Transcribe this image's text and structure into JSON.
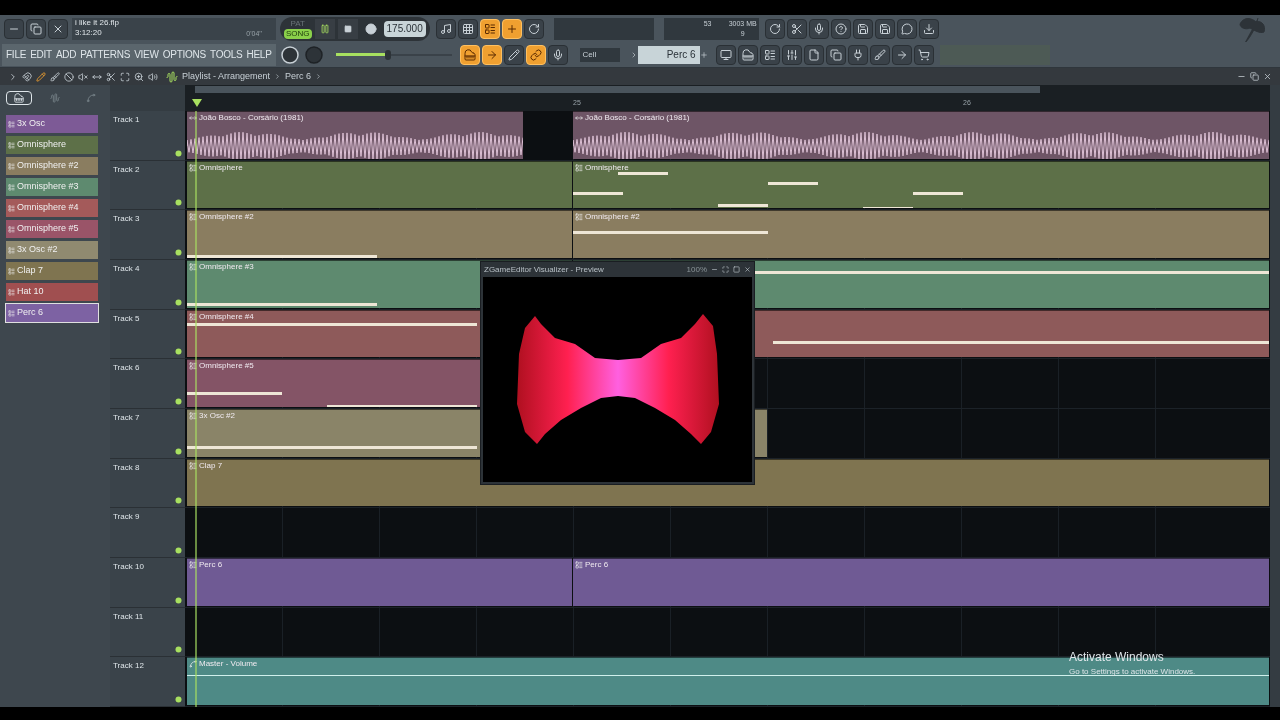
{
  "title_bar": {
    "project": "i like it 26.flp",
    "time": "3:12:20",
    "song_position": "0'04''"
  },
  "transport": {
    "modes": [
      {
        "label": "PAT",
        "selected": false
      },
      {
        "label": "SONG",
        "selected": true
      }
    ],
    "playing": true,
    "tempo": "175.000"
  },
  "monitor": {
    "cpu": "53",
    "memory": "3003 MB",
    "polyphony": "9"
  },
  "menu": [
    "FILE",
    "EDIT",
    "ADD",
    "PATTERNS",
    "VIEW",
    "OPTIONS",
    "TOOLS",
    "HELP"
  ],
  "master_volume": {
    "level": 0.45
  },
  "snap": "Cell",
  "pattern": "Perc 6",
  "playlist": {
    "title": "Playlist - Arrangement",
    "path": "Perc 6",
    "ruler": [
      "25",
      "26"
    ]
  },
  "picker_tabs": [
    {
      "kind": "patterns",
      "selected": true
    },
    {
      "kind": "audio",
      "selected": false
    },
    {
      "kind": "automation",
      "selected": false
    }
  ],
  "channels": [
    {
      "name": "3x Osc",
      "color": "#7d5a96",
      "selected": false
    },
    {
      "name": "Omnisphere",
      "color": "#5d7048",
      "selected": false
    },
    {
      "name": "Omnisphere #2",
      "color": "#8a7d60",
      "selected": false
    },
    {
      "name": "Omnisphere #3",
      "color": "#5e8a6f",
      "selected": false
    },
    {
      "name": "Omnisphere #4",
      "color": "#a45a5a",
      "selected": false
    },
    {
      "name": "Omnisphere #5",
      "color": "#9a5468",
      "selected": false
    },
    {
      "name": "3x Osc #2",
      "color": "#908a70",
      "selected": false
    },
    {
      "name": "Clap 7",
      "color": "#7f7450",
      "selected": false
    },
    {
      "name": "Hat 10",
      "color": "#a04f50",
      "selected": false
    },
    {
      "name": "Perc 6",
      "color": "#7d62a3",
      "selected": true
    }
  ],
  "tracks": [
    {
      "name": "Track 1",
      "clips": [
        {
          "label": "João Bosco - Corsário (1981)",
          "kind": "audio",
          "color": "#6e5566"
        },
        {
          "label": "João Bosco - Corsário (1981)",
          "kind": "audio",
          "color": "#6e5566"
        }
      ]
    },
    {
      "name": "Track 2",
      "clips": [
        {
          "label": "Omnisphere",
          "kind": "pattern",
          "color": "#5d7048"
        },
        {
          "label": "Omnisphere",
          "kind": "pattern",
          "color": "#5d7048"
        }
      ]
    },
    {
      "name": "Track 3",
      "clips": [
        {
          "label": "Omnisphere #2",
          "kind": "pattern",
          "color": "#8a7d60"
        },
        {
          "label": "Omnisphere #2",
          "kind": "pattern",
          "color": "#8a7d60"
        }
      ]
    },
    {
      "name": "Track 4",
      "clips": [
        {
          "label": "Omnisphere #3",
          "kind": "pattern",
          "color": "#5e8a6f"
        }
      ]
    },
    {
      "name": "Track 5",
      "clips": [
        {
          "label": "Omnisphere #4",
          "kind": "pattern",
          "color": "#8e5a5a"
        }
      ]
    },
    {
      "name": "Track 6",
      "clips": [
        {
          "label": "Omnisphere #5",
          "kind": "pattern",
          "color": "#845466"
        }
      ]
    },
    {
      "name": "Track 7",
      "clips": [
        {
          "label": "3x Osc #2",
          "kind": "pattern",
          "color": "#8a8468"
        }
      ]
    },
    {
      "name": "Track 8",
      "clips": [
        {
          "label": "Clap 7",
          "kind": "pattern",
          "color": "#7f7450"
        }
      ]
    },
    {
      "name": "Track 9"
    },
    {
      "name": "Track 10",
      "clips": [
        {
          "label": "Perc 6",
          "kind": "pattern",
          "color": "#6f5a94"
        },
        {
          "label": "Perc 6",
          "kind": "pattern",
          "color": "#6f5a94"
        }
      ]
    },
    {
      "name": "Track 11"
    },
    {
      "name": "Track 12",
      "clips": [
        {
          "label": "Master - Volume",
          "kind": "automation",
          "color": "#4e8a86"
        }
      ]
    }
  ],
  "visualizer": {
    "title": "ZGameEditor Visualizer - Preview",
    "zoom": "100%"
  },
  "windows_notice": {
    "title": "Activate Windows",
    "text": "Go to Settings to activate Windows."
  }
}
